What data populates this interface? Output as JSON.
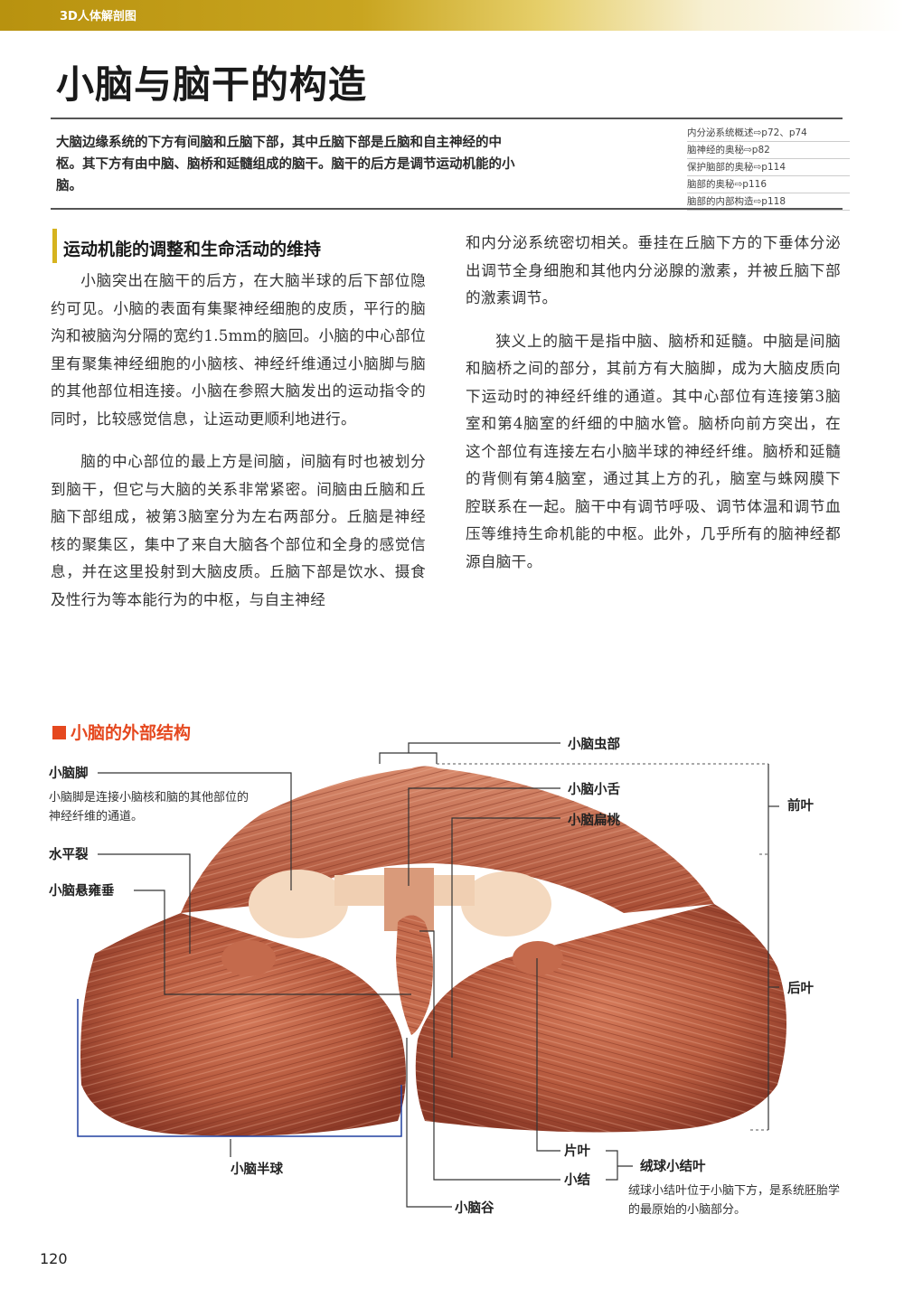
{
  "header": {
    "series": "3D人体解剖图"
  },
  "title": "小脑与脑干的构造",
  "summary": "大脑边缘系统的下方有间脑和丘脑下部，其中丘脑下部是丘脑和自主神经的中枢。其下方有由中脑、脑桥和延髓组成的脑干。脑干的后方是调节运动机能的小脑。",
  "references": [
    "内分泌系统概述⇨p72、p74",
    "脑神经的奥秘⇨p82",
    "保护脑部的奥秘⇨p114",
    "脑部的奥秘⇨p116",
    "脑部的内部构造⇨p118"
  ],
  "section_heading": "运动机能的调整和生命活动的维持",
  "left_column": [
    "小脑突出在脑干的后方，在大脑半球的后下部位隐约可见。小脑的表面有集聚神经细胞的皮质，平行的脑沟和被脑沟分隔的宽约1.5mm的脑回。小脑的中心部位里有聚集神经细胞的小脑核、神经纤维通过小脑脚与脑的其他部位相连接。小脑在参照大脑发出的运动指令的同时，比较感觉信息，让运动更顺利地进行。",
    "脑的中心部位的最上方是间脑，间脑有时也被划分到脑干，但它与大脑的关系非常紧密。间脑由丘脑和丘脑下部组成，被第3脑室分为左右两部分。丘脑是神经核的聚集区，集中了来自大脑各个部位和全身的感觉信息，并在这里投射到大脑皮质。丘脑下部是饮水、摄食及性行为等本能行为的中枢，与自主神经"
  ],
  "right_column": [
    "和内分泌系统密切相关。垂挂在丘脑下方的下垂体分泌出调节全身细胞和其他内分泌腺的激素，并被丘脑下部的激素调节。",
    "狭义上的脑干是指中脑、脑桥和延髓。中脑是间脑和脑桥之间的部分，其前方有大脑脚，成为大脑皮质向下运动时的神经纤维的通道。其中心部位有连接第3脑室和第4脑室的纤细的中脑水管。脑桥向前方突出，在这个部位有连接左右小脑半球的神经纤维。脑桥和延髓的背侧有第4脑室，通过其上方的孔，脑室与蛛网膜下腔联系在一起。脑干中有调节呼吸、调节体温和调节血压等维持生命机能的中枢。此外，几乎所有的脑神经都源自脑干。"
  ],
  "figure": {
    "title": "小脑的外部结构",
    "labels": {
      "peduncle": "小脑脚",
      "peduncle_note": "小脑脚是连接小脑核和脑的其他部位的神经纤维的通道。",
      "horizontal_fissure": "水平裂",
      "uvula": "小脑悬雍垂",
      "vermis": "小脑虫部",
      "lingula": "小脑小舌",
      "tonsil": "小脑扁桃",
      "anterior_lobe": "前叶",
      "posterior_lobe": "后叶",
      "hemisphere": "小脑半球",
      "flocculus": "片叶",
      "nodulus": "小结",
      "flocculonodular": "绒球小结叶",
      "flocculonodular_note": "绒球小结叶位于小脑下方，是系统胚胎学的最原始的小脑部分。",
      "vallecula": "小脑谷"
    }
  },
  "page_number": "120",
  "colors": {
    "accent_gold": "#c9a520",
    "figure_red": "#e5481f",
    "cerebellum": "#b65a3e"
  }
}
